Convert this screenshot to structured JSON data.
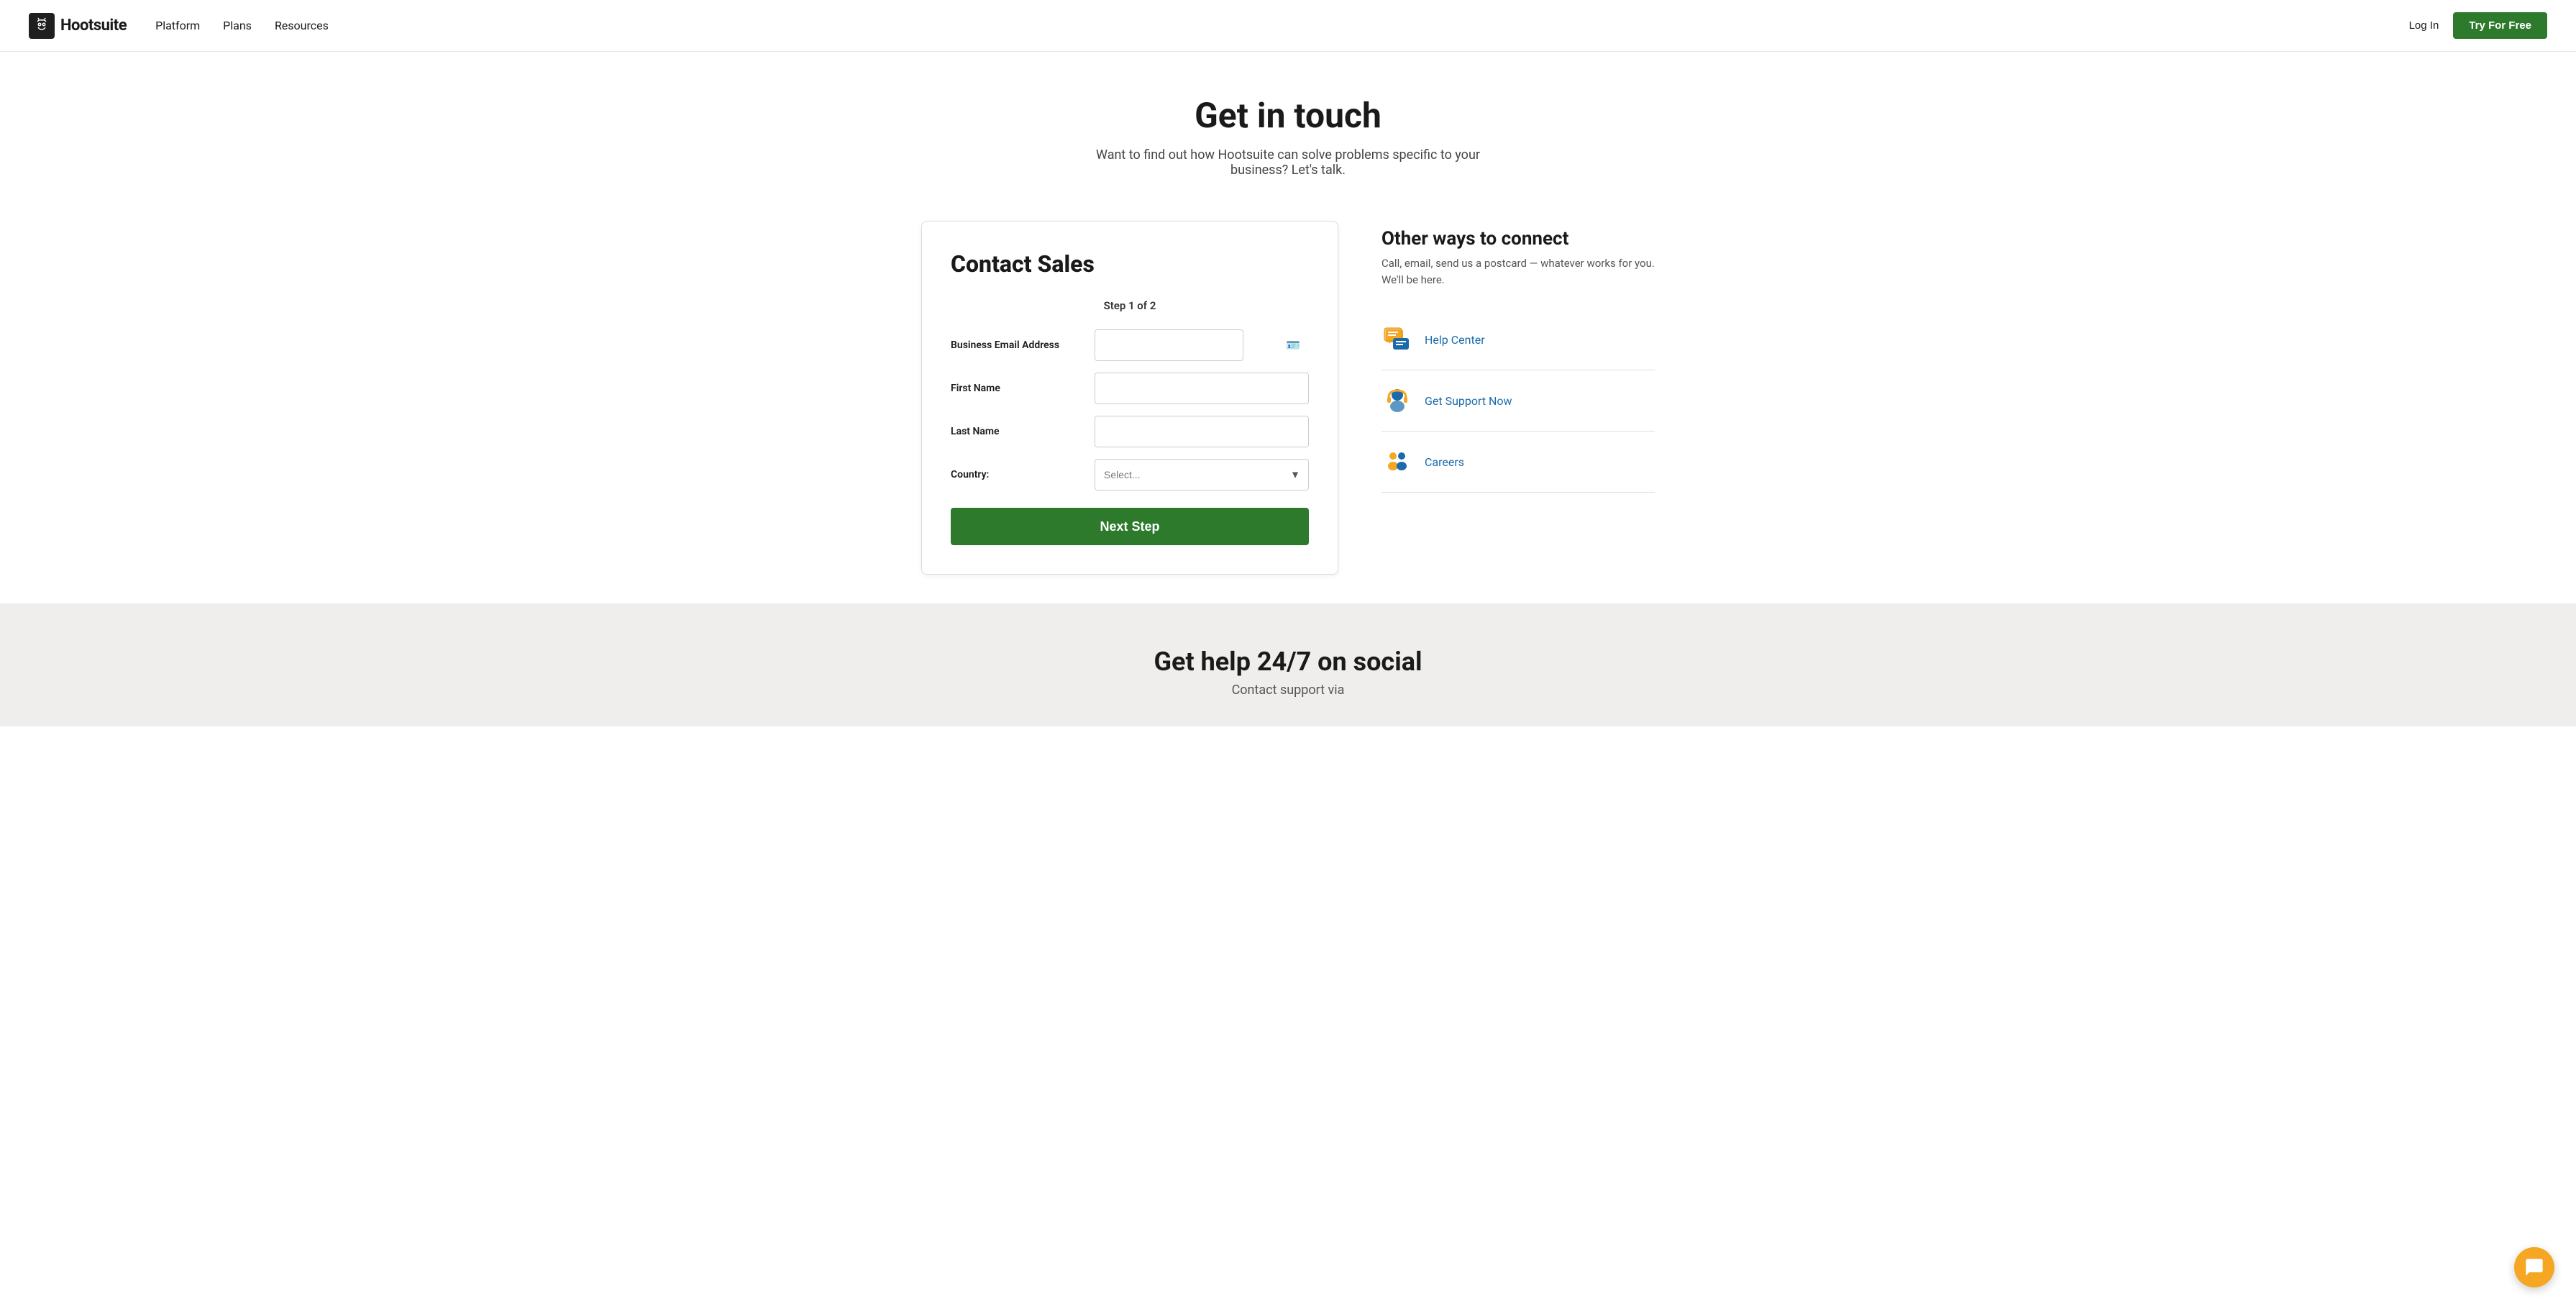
{
  "nav": {
    "logo_text": "Hootsuite",
    "links": [
      "Platform",
      "Plans",
      "Resources"
    ],
    "login_label": "Log In",
    "try_label": "Try For Free"
  },
  "hero": {
    "title": "Get in touch",
    "subtitle": "Want to find out how Hootsuite can solve problems specific to your business? Let's talk."
  },
  "form": {
    "heading": "Contact Sales",
    "step_label": "Step 1 of 2",
    "fields": {
      "email_label": "Business Email Address",
      "email_placeholder": "",
      "firstname_label": "First Name",
      "firstname_placeholder": "",
      "lastname_label": "Last Name",
      "lastname_placeholder": "",
      "country_label": "Country:",
      "country_placeholder": "Select..."
    },
    "submit_label": "Next Step"
  },
  "sidebar": {
    "heading": "Other ways to connect",
    "subtitle": "Call, email, send us a postcard — whatever works for you. We'll be here.",
    "items": [
      {
        "label": "Help Center",
        "icon": "help-center-icon"
      },
      {
        "label": "Get Support Now",
        "icon": "support-icon"
      },
      {
        "label": "Careers",
        "icon": "careers-icon"
      }
    ]
  },
  "bottom": {
    "heading": "Get help 24/7 on social",
    "subtext": "Contact support via"
  }
}
